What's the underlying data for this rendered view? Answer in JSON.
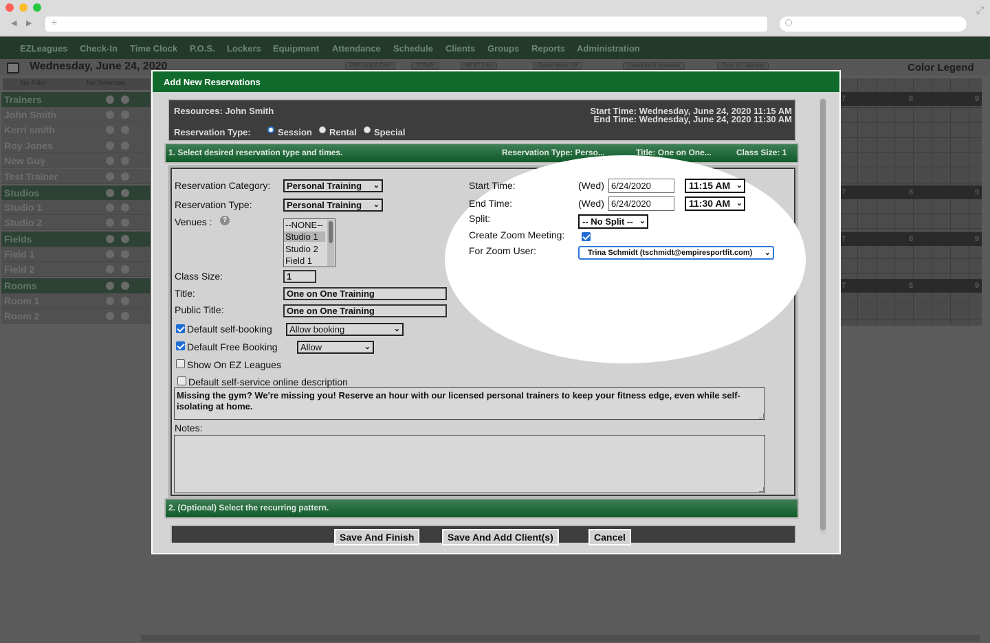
{
  "app_nav": [
    "EZLeagues",
    "Check-In",
    "Time Clock",
    "P.O.S.",
    "Lockers",
    "Equipment",
    "Attendance",
    "Schedule",
    "Clients",
    "Groups",
    "Reports",
    "Administration"
  ],
  "toolbar": {
    "date": "Wednesday, June 24, 2020",
    "previous_day": "PREVIOUS DAY",
    "today": "TODAY",
    "next_day": "NEXT DAY",
    "delete_mode": "Delete Mode Off",
    "waitlists": "0 waitlists 0 bookable",
    "sync": "Sync to Calendar",
    "color_legend": "Color Legend",
    "no_filter": "No Filter",
    "no_selection": "No Selection"
  },
  "sidebar": [
    {
      "label": "Trainers",
      "group": true
    },
    {
      "label": "John Smith",
      "group": false
    },
    {
      "label": "Kerri smith",
      "group": false
    },
    {
      "label": "Roy Jones",
      "group": false
    },
    {
      "label": "New Guy",
      "group": false
    },
    {
      "label": "Test Trainer",
      "group": false
    },
    {
      "label": "Studios",
      "group": true
    },
    {
      "label": "Studio 1",
      "group": false
    },
    {
      "label": "Studio 2",
      "group": false
    },
    {
      "label": "Fields",
      "group": true
    },
    {
      "label": "Field 1",
      "group": false
    },
    {
      "label": "Field 2",
      "group": false
    },
    {
      "label": "Rooms",
      "group": true
    },
    {
      "label": "Room 1",
      "group": false
    },
    {
      "label": "Room 2",
      "group": false
    }
  ],
  "grid_hours": [
    "7",
    "8",
    "9"
  ],
  "modal": {
    "title": "Add New Reservations",
    "resources": "Resources: John Smith",
    "start_time_header": "Start Time: Wednesday, June 24, 2020 11:15 AM",
    "end_time_header": "End Time: Wednesday, June 24, 2020 11:30 AM",
    "reservation_type_label": "Reservation Type:",
    "reservation_types": [
      "Session",
      "Rental",
      "Special"
    ],
    "reservation_type_selected": "Session",
    "section1": {
      "title": "1. Select desired reservation type and times.",
      "summary_type": "Reservation Type: Perso...",
      "summary_title": "Title: One on One...",
      "summary_size": "Class Size: 1"
    },
    "section2": {
      "title": "2. (Optional) Select the recurring pattern."
    },
    "form": {
      "category_label": "Reservation Category:",
      "category_value": "Personal Training",
      "type_label": "Reservation Type:",
      "type_value": "Personal Training",
      "venues_label": "Venues :",
      "venues_options": [
        "--NONE--",
        "Studio 1",
        "Studio 2",
        "Field 1"
      ],
      "venues_selected": "Studio 1",
      "class_size_label": "Class Size:",
      "class_size_value": "1",
      "title_label": "Title:",
      "title_value": "One on One Training",
      "public_title_label": "Public Title:",
      "public_title_value": "One on One Training",
      "self_booking_label": "Default self-booking",
      "self_booking_value": "Allow booking",
      "free_booking_label": "Default Free Booking",
      "free_booking_value": "Allow",
      "show_ez_label": "Show On EZ Leagues",
      "online_desc_label": "Default self-service online description",
      "description": "Missing the gym? We're missing you! Reserve an hour with our licensed personal trainers to keep your fitness edge, even while self-isolating at home.",
      "notes_label": "Notes:",
      "notes_value": ""
    },
    "times": {
      "start_label": "Start Time:",
      "start_day": "(Wed)",
      "start_date": "6/24/2020",
      "start_time": "11:15 AM",
      "end_label": "End Time:",
      "end_day": "(Wed)",
      "end_date": "6/24/2020",
      "end_time": "11:30 AM",
      "split_label": "Split:",
      "split_value": "-- No Split --",
      "zoom_meeting_label": "Create Zoom Meeting:",
      "zoom_user_label": "For Zoom User:",
      "zoom_user_value": "Trina Schmidt (tschmidt@empiresportfit.com)"
    },
    "buttons": {
      "save_finish": "Save And Finish",
      "save_add_clients": "Save And Add Client(s)",
      "cancel": "Cancel"
    }
  }
}
